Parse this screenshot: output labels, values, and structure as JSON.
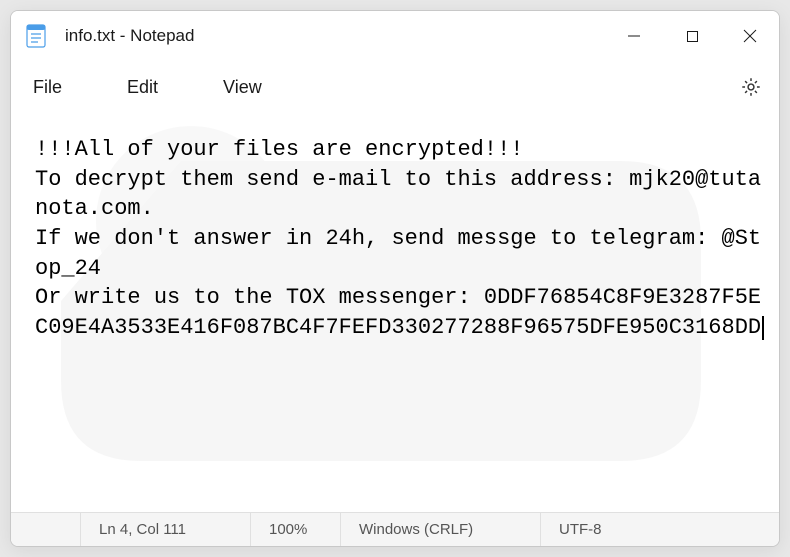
{
  "titlebar": {
    "title": "info.txt - Notepad"
  },
  "menubar": {
    "file": "File",
    "edit": "Edit",
    "view": "View"
  },
  "content": {
    "text": "!!!All of your files are encrypted!!!\nTo decrypt them send e-mail to this address: mjk20@tutanota.com.\nIf we don't answer in 24h, send messge to telegram: @Stop_24\nOr write us to the TOX messenger: 0DDF76854C8F9E3287F5EC09E4A3533E416F087BC4F7FEFD330277288F96575DFE950C3168DD"
  },
  "statusbar": {
    "position": "Ln 4, Col 111",
    "zoom": "100%",
    "line_ending": "Windows (CRLF)",
    "encoding": "UTF-8"
  }
}
